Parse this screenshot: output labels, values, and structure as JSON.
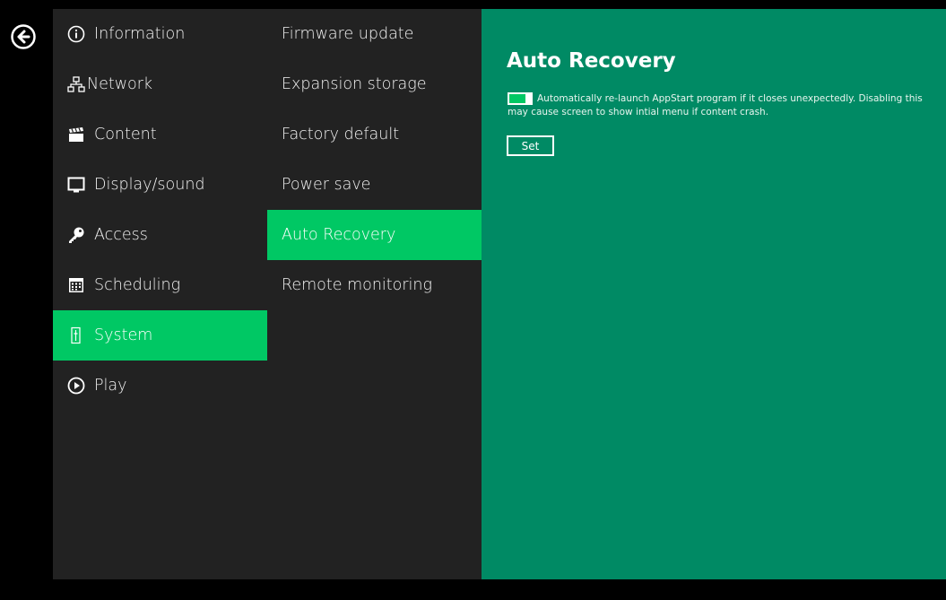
{
  "colors": {
    "accent": "#00c864",
    "panel": "#008a64",
    "sidebar": "#222222"
  },
  "nav": {
    "items": [
      {
        "label": "Information",
        "icon": "info-icon"
      },
      {
        "label": "Network",
        "icon": "network-icon"
      },
      {
        "label": "Content",
        "icon": "clapperboard-icon"
      },
      {
        "label": "Display/sound",
        "icon": "monitor-icon"
      },
      {
        "label": "Access",
        "icon": "key-icon"
      },
      {
        "label": "Scheduling",
        "icon": "calendar-icon"
      },
      {
        "label": "System",
        "icon": "system-icon",
        "active": true
      },
      {
        "label": "Play",
        "icon": "play-icon"
      }
    ]
  },
  "submenu": {
    "items": [
      {
        "label": "Firmware update"
      },
      {
        "label": "Expansion storage"
      },
      {
        "label": "Factory default"
      },
      {
        "label": "Power save"
      },
      {
        "label": "Auto Recovery",
        "active": true
      },
      {
        "label": "Remote monitoring"
      }
    ]
  },
  "panel": {
    "title": "Auto Recovery",
    "toggle_on": true,
    "description": "Automatically re-launch AppStart program if it closes unexpectedly. Disabling this may cause screen to show intial menu if content crash.",
    "set_label": "Set"
  }
}
